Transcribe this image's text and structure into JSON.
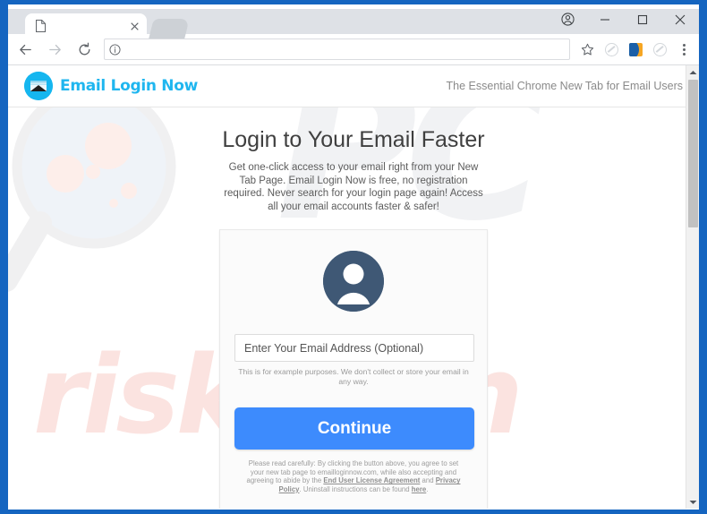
{
  "browser": {
    "tab": {
      "title": "",
      "favicon_icon": "page-icon",
      "close_icon": "close-icon"
    },
    "new_tab_button_icon": "new-tab-icon",
    "window_controls": {
      "profile_icon": "profile-icon",
      "minimize_icon": "minimize-icon",
      "maximize_icon": "maximize-icon",
      "close_icon": "close-icon"
    },
    "toolbar": {
      "back_icon": "back-arrow-icon",
      "forward_icon": "forward-arrow-icon",
      "reload_icon": "reload-icon",
      "page_info_icon": "info-circle-icon",
      "url_value": "",
      "url_placeholder": "",
      "bookmark_icon": "star-icon",
      "extension_1_icon": "extension-faded-icon",
      "extension_2_icon": "extension-moon-icon",
      "extension_3_icon": "extension-faded-icon",
      "menu_icon": "three-dots-menu-icon"
    },
    "scrollbar": {
      "up_arrow_icon": "scroll-up-arrow-icon",
      "down_arrow_icon": "scroll-down-arrow-icon"
    }
  },
  "site": {
    "header": {
      "logo_icon": "envelope-logo-icon",
      "brand_name": "Email Login Now",
      "tagline": "The Essential Chrome New Tab for Email Users"
    },
    "hero": {
      "headline": "Login to Your Email Faster",
      "description": "Get one-click access to your email right from your New Tab Page. Email Login Now is free, no registration required. Never search for your login page again! Access all your email accounts faster & safer!"
    },
    "card": {
      "avatar_icon": "user-avatar-icon",
      "email_placeholder": "Enter Your Email Address (Optional)",
      "email_value": "",
      "disclaimer": "This is for example purposes. We don't collect or store your email in any way.",
      "continue_label": "Continue",
      "legal": {
        "part1": "Please read carefully: By clicking the button above, you agree to set your new tab page to emailloginnow.com, while also accepting and agreeing to abide by the ",
        "link_eula": "End User License Agreement",
        "part2": " and ",
        "link_privacy": "Privacy Policy",
        "part3": ". Uninstall instructions can be found ",
        "link_here": "here",
        "part4": "."
      }
    },
    "watermarks": {
      "pc_text": "PC",
      "risk_text": "risk.com",
      "magnifier_icon": "magnifier-watermark-icon"
    }
  },
  "colors": {
    "frame_blue": "#1565c0",
    "brand_cyan": "#1fb6ef",
    "button_blue": "#3d8bfd",
    "avatar_slate": "#3f5875",
    "watermark_pink": "#fbe3e0",
    "watermark_grey": "#f1f2f4"
  }
}
